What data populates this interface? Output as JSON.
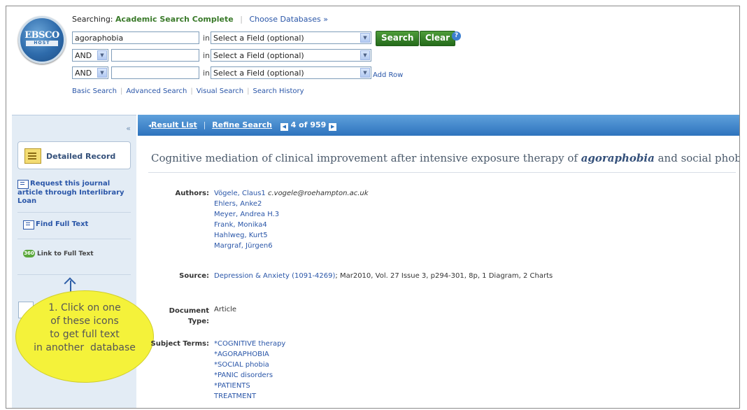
{
  "header": {
    "searching_label": "Searching:",
    "database": "Academic Search Complete",
    "choose_databases": "Choose Databases »",
    "logo_top": "EBSCO",
    "logo_bottom": "HOST",
    "search_rows": [
      {
        "operator": "",
        "term": "agoraphobia",
        "in": "in",
        "field": "Select a Field (optional)"
      },
      {
        "operator": "AND",
        "term": "",
        "in": "in",
        "field": "Select a Field (optional)"
      },
      {
        "operator": "AND",
        "term": "",
        "in": "in",
        "field": "Select a Field (optional)"
      }
    ],
    "search_button": "Search",
    "clear_button": "Clear",
    "help_icon": "?",
    "add_row": "Add Row",
    "tabs": [
      "Basic Search",
      "Advanced Search",
      "Visual Search",
      "Search History"
    ]
  },
  "sidebar": {
    "collapse": "«",
    "detailed_record": "Detailed Record",
    "request_journal": "Request this journal article through Interlibrary Loan",
    "find_full_text": "Find Full Text",
    "link_full_text": "Link to Full Text",
    "badge": "360"
  },
  "callout": {
    "text_lines": [
      "1. Click on one",
      "of these icons",
      "to get full text",
      "in another  database"
    ]
  },
  "result_bar": {
    "result_list": "Result List",
    "refine_search": "Refine Search",
    "position": "4 of 959"
  },
  "record": {
    "title_before": "Cognitive mediation of clinical improvement after intensive exposure therapy of ",
    "title_keyword": "agoraphobia",
    "title_after": " and social phobia.",
    "authors_label": "Authors:",
    "authors": [
      "Vögele, Claus1",
      "Ehlers, Anke2",
      "Meyer, Andrea H.3",
      "Frank, Monika4",
      "Hahlweg, Kurt5",
      "Margraf, Jürgen6"
    ],
    "author_email": "c.vogele@roehampton.ac.uk",
    "source_label": "Source:",
    "source_link": "Depression & Anxiety (1091-4269)",
    "source_rest": "; Mar2010, Vol. 27 Issue 3, p294-301, 8p, 1 Diagram, 2 Charts",
    "doctype_label_1": "Document",
    "doctype_label_2": "Type:",
    "doctype": "Article",
    "subjects_label": "Subject Terms:",
    "subjects": [
      "*COGNITIVE therapy",
      "*AGORAPHOBIA",
      "*SOCIAL phobia",
      "*PANIC disorders",
      "*PATIENTS",
      "TREATMENT"
    ]
  }
}
